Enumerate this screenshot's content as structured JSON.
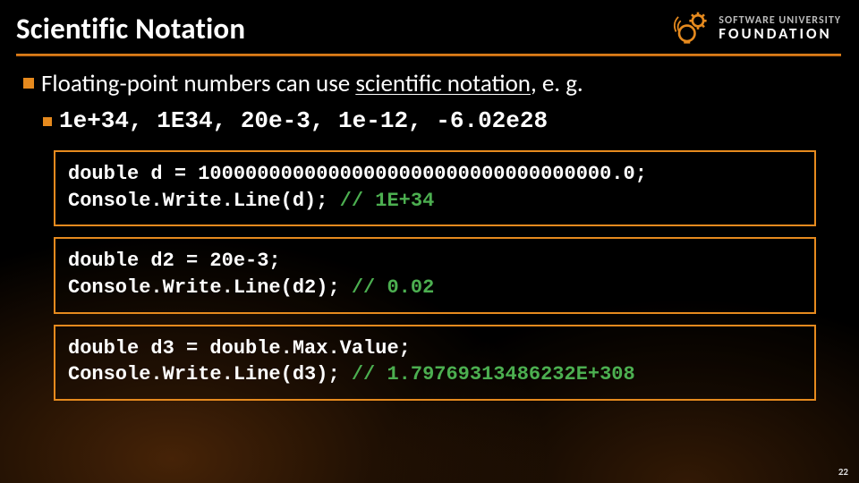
{
  "header": {
    "title": "Scientific Notation",
    "logo_line1": "SOFTWARE UNIVERSITY",
    "logo_line2": "FOUNDATION"
  },
  "bullets": {
    "main_pre": "Floating-point numbers can use ",
    "main_underlined": "scientific notation",
    "main_post": ", e. g.",
    "sub": "1e+34, 1E34, 20e-3, 1e-12, -6.02e28"
  },
  "code_blocks": [
    {
      "line1": "double d = 10000000000000000000000000000000000.0;",
      "line2_a": "Console.Write.Line(d); ",
      "line2_b": "// 1E+34"
    },
    {
      "line1": "double d2 = 20e-3;",
      "line2_a": "Console.Write.Line(d2); ",
      "line2_b": "// 0.02"
    },
    {
      "line1": "double d3 = double.Max.Value;",
      "line2_a": "Console.Write.Line(d3); ",
      "line2_b": "// 1.79769313486232E+308"
    }
  ],
  "page_number": "22"
}
